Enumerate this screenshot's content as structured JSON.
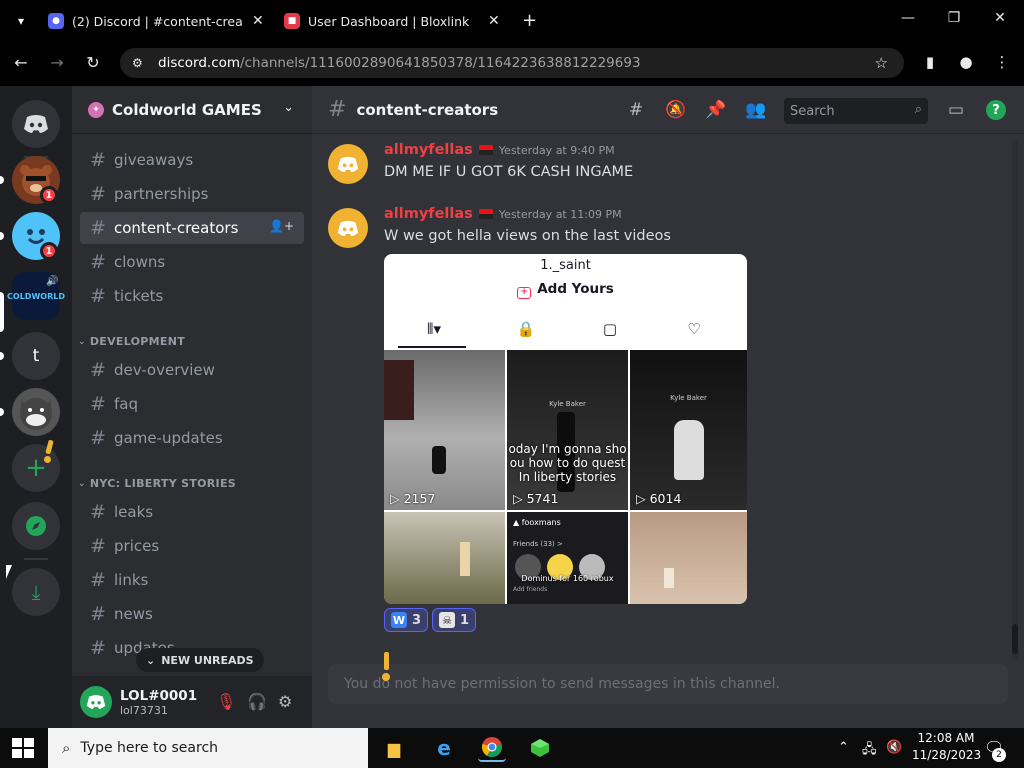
{
  "browser": {
    "tabs": [
      {
        "title": "(2) Discord | #content-creators |",
        "active": true
      },
      {
        "title": "User Dashboard | Bloxlink",
        "active": false
      }
    ],
    "url_host": "discord.com",
    "url_path": "/channels/1116002890641850378/1164223638812229693",
    "accent": "#5865f2"
  },
  "rail": {
    "badges": [
      "1",
      "1"
    ],
    "server_t_label": "t",
    "coldworld_label": "COLDWORLD"
  },
  "sidebar": {
    "guild_name": "Coldworld GAMES",
    "channels_top": [
      {
        "name": "giveaways"
      },
      {
        "name": "partnerships"
      },
      {
        "name": "content-creators",
        "active": true
      },
      {
        "name": "clowns"
      },
      {
        "name": "tickets"
      }
    ],
    "categories": [
      {
        "name": "DEVELOPMENT",
        "channels": [
          {
            "name": "dev-overview"
          },
          {
            "name": "faq"
          },
          {
            "name": "game-updates"
          }
        ]
      },
      {
        "name": "NYC: LIBERTY STORIES",
        "channels": [
          {
            "name": "leaks"
          },
          {
            "name": "prices"
          },
          {
            "name": "links"
          },
          {
            "name": "news"
          },
          {
            "name": "updates"
          }
        ]
      }
    ],
    "new_unreads": "NEW UNREADS",
    "user": {
      "name": "LOL#0001",
      "status": "lol73731"
    }
  },
  "chat": {
    "channel_name": "content-creators",
    "search_placeholder": "Search",
    "messages": [
      {
        "author": "allmyfellas",
        "time": "Yesterday at 9:40 PM",
        "text": "DM ME IF U GOT 6K CASH INGAME"
      },
      {
        "author": "allmyfellas",
        "time": "Yesterday at 11:09 PM",
        "text": "W we got hella views on the last videos"
      }
    ],
    "embed": {
      "profile_user": "1._saint",
      "add_yours": "Add Yours",
      "videos": [
        {
          "views": "2157",
          "caption": ""
        },
        {
          "views": "5741",
          "caption": "oday I'm gonna sho\nou how to do quest\nIn liberty stories",
          "overlay": "Kyle Baker"
        },
        {
          "views": "6014",
          "caption": "",
          "overlay": "Kyle Baker"
        },
        {
          "views": "",
          "caption": ""
        },
        {
          "views": "",
          "caption": "",
          "profile": "fooxmans",
          "friends": "Friends (33) >",
          "overlay": "Dominus for 160 robux",
          "add_friends": "Add friends"
        },
        {
          "views": "",
          "caption": ""
        }
      ]
    },
    "reactions": [
      {
        "emoji": "W",
        "count": "3"
      },
      {
        "emoji": "skull",
        "count": "1"
      }
    ],
    "composer_placeholder": "You do not have permission to send messages in this channel."
  },
  "taskbar": {
    "search_placeholder": "Type here to search",
    "time": "12:08 AM",
    "date": "11/28/2023",
    "notification_count": "2"
  }
}
